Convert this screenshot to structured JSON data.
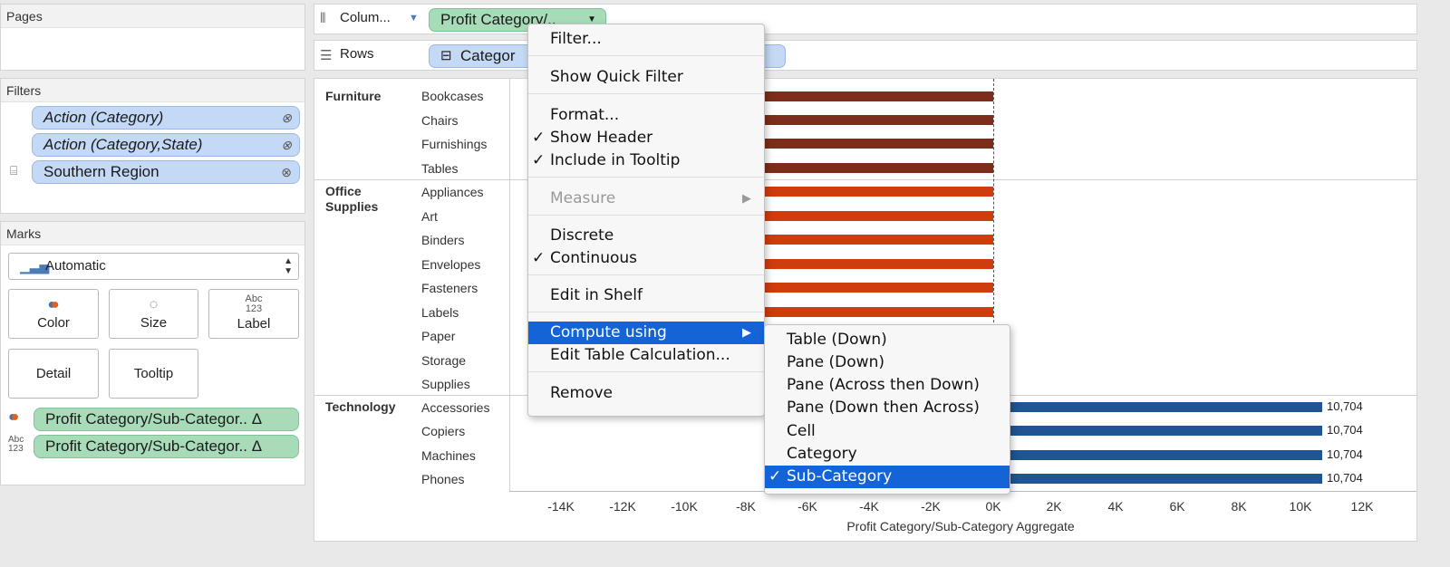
{
  "sidebar": {
    "pages_title": "Pages",
    "filters_title": "Filters",
    "filters": [
      {
        "label": "Action (Category)"
      },
      {
        "label": "Action (Category,State)"
      },
      {
        "label": "Southern Region"
      }
    ],
    "marks_title": "Marks",
    "mark_type": "Automatic",
    "mark_buttons": {
      "color": "Color",
      "size": "Size",
      "label": "Label",
      "detail": "Detail",
      "tooltip": "Tooltip"
    },
    "label_icon_text": "Abc\n123",
    "mark_fields": [
      {
        "label": "Profit Category/Sub-Categor.. Δ"
      },
      {
        "label": "Profit Category/Sub-Categor.. Δ"
      }
    ]
  },
  "shelves": {
    "columns_label": "Colum...",
    "columns_pill": "Profit Category/..",
    "rows_label": "Rows",
    "rows_pill": "Categor"
  },
  "view": {
    "categories": [
      {
        "name": "Furniture",
        "subs": [
          "Bookcases",
          "Chairs",
          "Furnishings",
          "Tables"
        ]
      },
      {
        "name": "Office\nSupplies",
        "subs": [
          "Appliances",
          "Art",
          "Binders",
          "Envelopes",
          "Fasteners",
          "Labels",
          "Paper",
          "Storage",
          "Supplies"
        ]
      },
      {
        "name": "Technology",
        "subs": [
          "Accessories",
          "Copiers",
          "Machines",
          "Phones"
        ]
      }
    ],
    "tech_value_label": "10,704",
    "axis_title": "Profit Category/Sub-Category Aggregate",
    "axis_ticks": [
      "-14K",
      "-12K",
      "-10K",
      "-8K",
      "-6K",
      "-4K",
      "-2K",
      "0K",
      "2K",
      "4K",
      "6K",
      "8K",
      "10K",
      "12K"
    ],
    "colors": {
      "furniture": "#7e2d1a",
      "office": "#cf3c0e",
      "technology": "#1f5592"
    }
  },
  "context_menu": {
    "items": [
      "Filter...",
      "Show Quick Filter",
      "Format...",
      "Show Header",
      "Include in Tooltip",
      "Measure",
      "Discrete",
      "Continuous",
      "Edit in Shelf",
      "Compute using",
      "Edit Table Calculation...",
      "Remove"
    ]
  },
  "submenu": {
    "items": [
      "Table (Down)",
      "Pane (Down)",
      "Pane (Across then Down)",
      "Pane (Down then Across)",
      "Cell",
      "Category",
      "Sub-Category"
    ]
  }
}
